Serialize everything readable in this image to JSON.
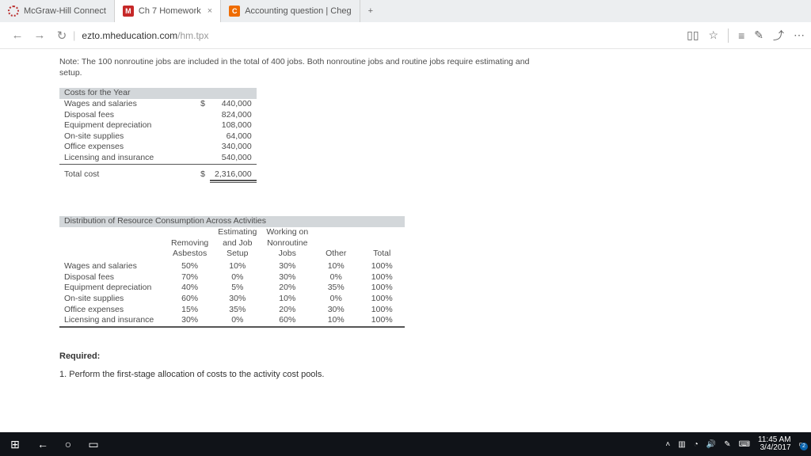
{
  "tabs": [
    {
      "label": "McGraw-Hill Connect"
    },
    {
      "label": "Ch 7 Homework"
    },
    {
      "label": "Accounting question | Cheg"
    }
  ],
  "url": {
    "host": "ezto.mheducation.com",
    "path": "/hm.tpx"
  },
  "note": "Note: The 100 nonroutine jobs are included in the total of 400 jobs. Both nonroutine jobs and routine jobs require estimating and setup.",
  "costs": {
    "title": "Costs for the Year",
    "rows": [
      {
        "label": "Wages and salaries",
        "prefix": "$",
        "value": "440,000"
      },
      {
        "label": "Disposal fees",
        "prefix": "",
        "value": "824,000"
      },
      {
        "label": "Equipment depreciation",
        "prefix": "",
        "value": "108,000"
      },
      {
        "label": "On-site supplies",
        "prefix": "",
        "value": "64,000"
      },
      {
        "label": "Office expenses",
        "prefix": "",
        "value": "340,000"
      },
      {
        "label": "Licensing and insurance",
        "prefix": "",
        "value": "540,000"
      }
    ],
    "total": {
      "label": "Total cost",
      "prefix": "$",
      "value": "2,316,000"
    }
  },
  "dist": {
    "title": "Distribution of Resource Consumption Across Activities",
    "columns": [
      "",
      "Removing Asbestos",
      "Estimating and Job Setup",
      "Working on Nonroutine Jobs",
      "Other",
      "Total"
    ],
    "rows": [
      {
        "label": "Wages and salaries",
        "v": [
          "50%",
          "10%",
          "30%",
          "10%",
          "100%"
        ]
      },
      {
        "label": "Disposal fees",
        "v": [
          "70%",
          "0%",
          "30%",
          "0%",
          "100%"
        ]
      },
      {
        "label": "Equipment depreciation",
        "v": [
          "40%",
          "5%",
          "20%",
          "35%",
          "100%"
        ]
      },
      {
        "label": "On-site supplies",
        "v": [
          "60%",
          "30%",
          "10%",
          "0%",
          "100%"
        ]
      },
      {
        "label": "Office expenses",
        "v": [
          "15%",
          "35%",
          "20%",
          "30%",
          "100%"
        ]
      },
      {
        "label": "Licensing and insurance",
        "v": [
          "30%",
          "0%",
          "60%",
          "10%",
          "100%"
        ]
      }
    ]
  },
  "required": {
    "title": "Required:",
    "item": "1.  Perform the first-stage allocation of costs to the activity cost pools."
  },
  "clock": {
    "time": "11:45 AM",
    "date": "3/4/2017"
  }
}
